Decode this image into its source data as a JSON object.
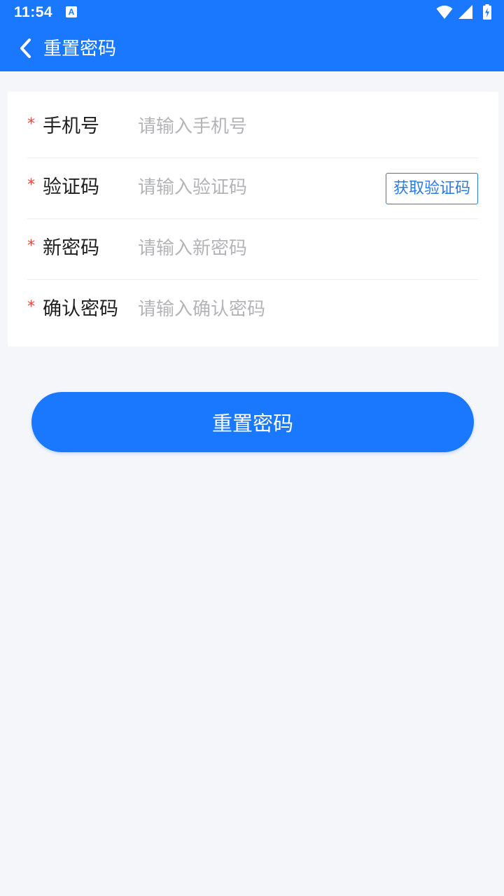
{
  "status_bar": {
    "time": "11:54",
    "notification_icon": "A",
    "icons": [
      "wifi-icon",
      "signal-icon",
      "battery-charging-icon"
    ]
  },
  "app_bar": {
    "back_icon": "chevron-left-icon",
    "title": "重置密码"
  },
  "form": {
    "required_mark": "*",
    "phone": {
      "label": "手机号",
      "placeholder": "请输入手机号",
      "value": ""
    },
    "code": {
      "label": "验证码",
      "placeholder": "请输入验证码",
      "value": "",
      "get_code_label": "获取验证码"
    },
    "new_password": {
      "label": "新密码",
      "placeholder": "请输入新密码",
      "value": ""
    },
    "confirm_password": {
      "label": "确认密码",
      "placeholder": "请输入确认密码",
      "value": ""
    }
  },
  "submit_label": "重置密码",
  "colors": {
    "primary": "#1a78ff",
    "required": "#e34b3f",
    "background": "#f4f6fa",
    "placeholder": "#b2b4b8",
    "outline_button": "#2a7be0"
  }
}
